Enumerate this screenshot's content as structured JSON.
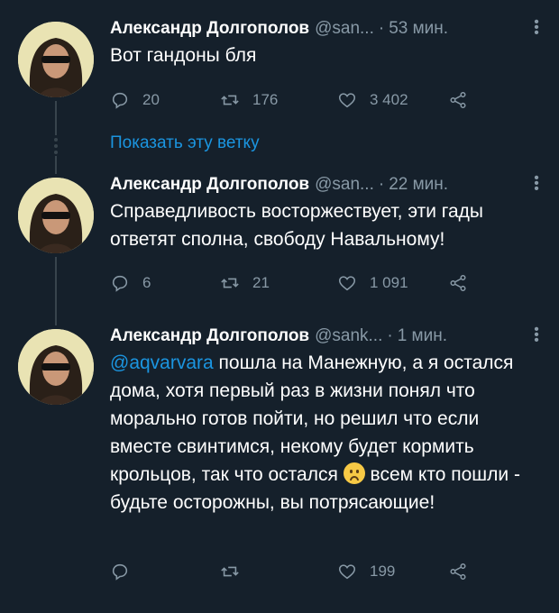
{
  "tweets": [
    {
      "name": "Александр Долгополов",
      "handle": "@san...",
      "time": "53 мин.",
      "text": "Вот гандоны бля",
      "replies": "20",
      "retweets": "176",
      "likes": "3 402"
    },
    {
      "name": "Александр Долгополов",
      "handle": "@san...",
      "time": "22 мин.",
      "text": "Справедливость восторжествует, эти гады ответят сполна, свободу Навальному!",
      "replies": "6",
      "retweets": "21",
      "likes": "1 091"
    },
    {
      "name": "Александр Долгополов",
      "handle": "@sank...",
      "time": "1 мин.",
      "mention": "@aqvarvara",
      "text": " пошла на Манежную, а я остался дома, хотя первый раз в жизни понял что морально готов пойти, но решил что если вместе свинтимся, некому будет кормить крольцов, так что остался ",
      "text_after_emoji": " всем кто пошли - будьте осторожны, вы потрясающие!",
      "replies": "",
      "retweets": "",
      "likes": "199"
    }
  ],
  "show_thread": "Показать эту ветку",
  "separator": "·",
  "colors": {
    "background": "#15202b",
    "secondary": "#8899a6",
    "accent": "#1b95e0"
  }
}
